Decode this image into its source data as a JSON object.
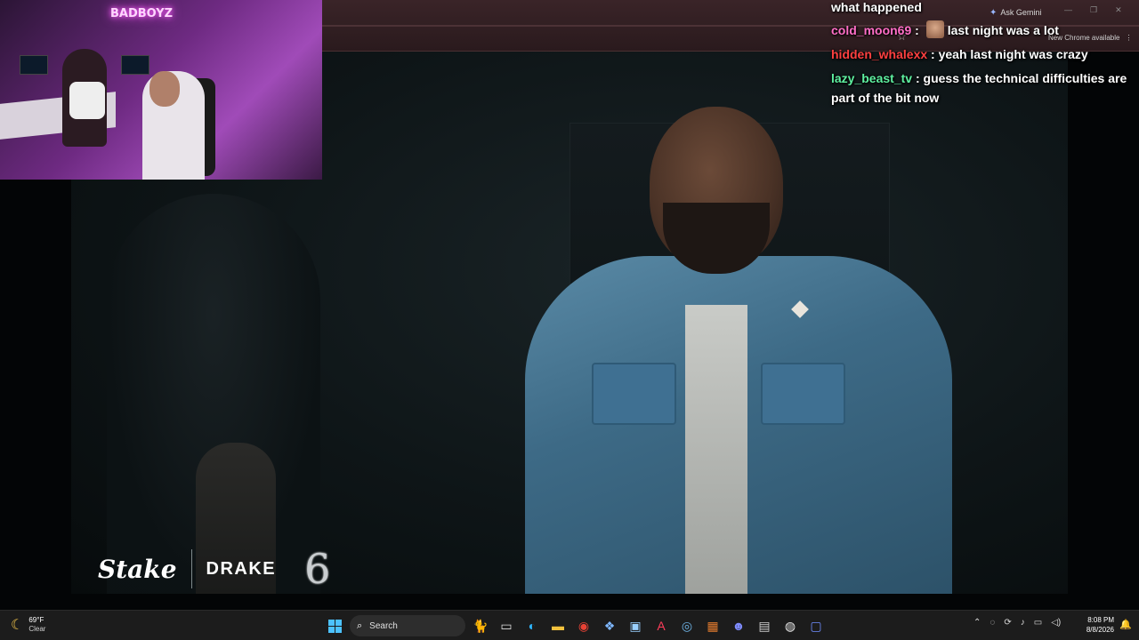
{
  "browser": {
    "ask_gemini": "Ask Gemini",
    "new_chrome": "New Chrome available",
    "window_controls": [
      "—",
      "❐",
      "✕"
    ]
  },
  "chat": {
    "previous_message": "what happened",
    "messages": [
      {
        "user": "cold_moon69",
        "separator": ":",
        "text": "last night was a lot",
        "user_color": "#ff6ec7",
        "has_emote": true
      },
      {
        "user": "hidden_whalexx",
        "separator": ":",
        "text": "yeah last night was crazy",
        "user_color": "#ff4040"
      },
      {
        "user": "lazy_beast_tv",
        "separator": ":",
        "text": "guess the technical difficulties are part of the bit now",
        "user_color": "#5ef0a0"
      }
    ]
  },
  "webcam": {
    "neon_sign": "BADBOYZ"
  },
  "sponsor": {
    "stake": "Stake",
    "drake": "DRAKE",
    "six": "6"
  },
  "taskbar": {
    "weather": {
      "temp": "69°F",
      "condition": "Clear",
      "icon": "moon-icon"
    },
    "search_label": "Search",
    "apps": [
      "cat-widget-icon",
      "task-view-icon",
      "edge-icon",
      "file-explorer-icon",
      "chrome-icon",
      "copilot-icon",
      "store-icon",
      "adobe-icon",
      "steam-icon",
      "game-icon",
      "discord-icon",
      "terminal-icon",
      "obs-icon",
      "app-icon"
    ],
    "clock": {
      "time": "8:08 PM",
      "date": "8/8/2026"
    }
  },
  "colors": {
    "taskbar_bg": "#1c1c1c",
    "accent": "#4cc2ff"
  }
}
